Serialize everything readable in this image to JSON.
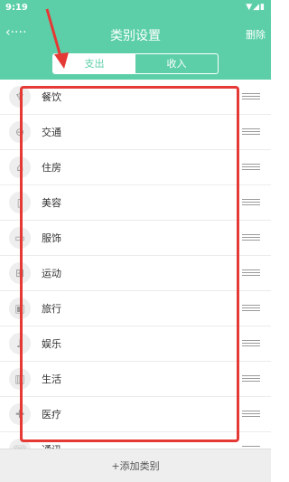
{
  "status_bar": {
    "time": "9:19",
    "icons": "▼◢▮"
  },
  "header": {
    "back_icon": "‹····",
    "title": "类别设置",
    "delete_label": "删除"
  },
  "tabs": [
    {
      "label": "支出",
      "selected": true
    },
    {
      "label": "收入",
      "selected": false
    }
  ],
  "categories": [
    {
      "label": "餐饮",
      "icon": "fork-icon",
      "glyph": "♆"
    },
    {
      "label": "交通",
      "icon": "car-icon",
      "glyph": "⊖"
    },
    {
      "label": "住房",
      "icon": "house-icon",
      "glyph": "⌂"
    },
    {
      "label": "美容",
      "icon": "bottle-icon",
      "glyph": "▯"
    },
    {
      "label": "服饰",
      "icon": "clothes-icon",
      "glyph": "▭"
    },
    {
      "label": "运动",
      "icon": "dumbbell-icon",
      "glyph": "⊞"
    },
    {
      "label": "旅行",
      "icon": "luggage-icon",
      "glyph": "▣"
    },
    {
      "label": "娱乐",
      "icon": "microphone-icon",
      "glyph": "♪"
    },
    {
      "label": "生活",
      "icon": "book-icon",
      "glyph": "▥"
    },
    {
      "label": "医疗",
      "icon": "medical-kit-icon",
      "glyph": "✚"
    },
    {
      "label": "通讯",
      "icon": "phone-icon",
      "glyph": "☏"
    }
  ],
  "bottom_button": {
    "label": "+添加类别"
  },
  "colors": {
    "accent": "#5ccfa9",
    "annotation": "#e53935"
  }
}
